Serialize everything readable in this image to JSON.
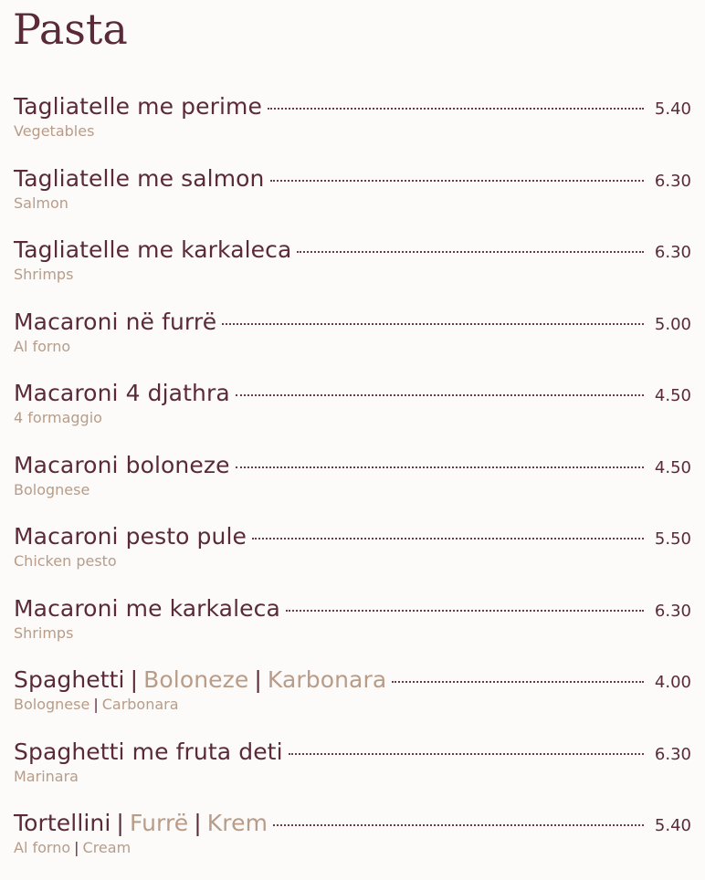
{
  "title": "Pasta",
  "items": [
    {
      "name": "Tagliatelle me perime",
      "sub": "Vegetables",
      "price": "5.40"
    },
    {
      "name": "Tagliatelle me salmon",
      "sub": "Salmon",
      "price": "6.30"
    },
    {
      "name": "Tagliatelle me karkaleca",
      "sub": "Shrimps",
      "price": "6.30"
    },
    {
      "name": "Macaroni në furrë",
      "sub": "Al forno",
      "price": "5.00"
    },
    {
      "name": "Macaroni 4 djathra",
      "sub": "4 formaggio",
      "price": "4.50"
    },
    {
      "name": "Macaroni boloneze",
      "sub": "Bolognese",
      "price": "4.50"
    },
    {
      "name": "Macaroni pesto pule",
      "sub": "Chicken pesto",
      "price": "5.50"
    },
    {
      "name": "Macaroni me karkaleca",
      "sub": "Shrimps",
      "price": "6.30"
    },
    {
      "name": "Spaghetti",
      "variants": [
        "Boloneze",
        "Karbonara"
      ],
      "sub_parts": [
        "Bolognese",
        "Carbonara"
      ],
      "price": "4.00"
    },
    {
      "name": "Spaghetti me fruta deti",
      "sub": "Marinara",
      "price": "6.30"
    },
    {
      "name": "Tortellini",
      "variants": [
        "Furrë",
        "Krem"
      ],
      "sub_parts": [
        "Al forno",
        "Cream"
      ],
      "price": "5.40"
    }
  ],
  "separator": "|",
  "colors": {
    "background": "#fcfbf9",
    "primary": "#5a2a3a",
    "secondary": "#b89c88"
  }
}
